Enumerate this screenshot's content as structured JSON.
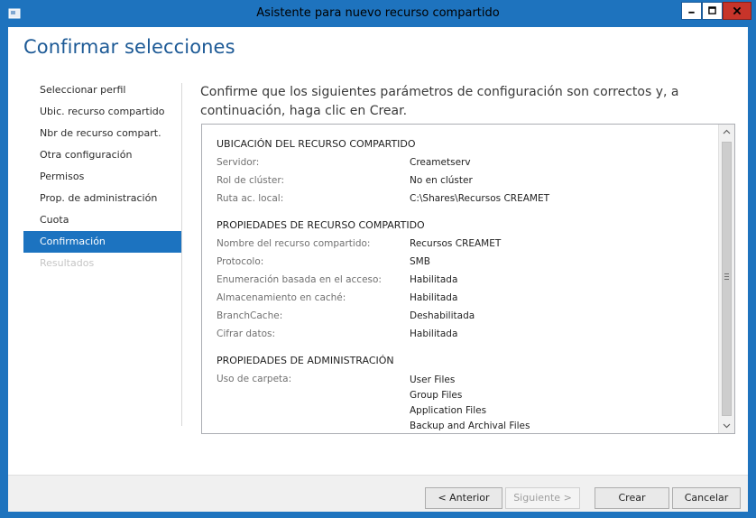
{
  "window": {
    "title": "Asistente para nuevo recurso compartido",
    "icon": "wizard-app-icon",
    "controls": [
      "minimize-icon",
      "maximize-icon",
      "close-icon"
    ]
  },
  "page": {
    "heading": "Confirmar selecciones",
    "intro": "Confirme que los siguientes parámetros de configuración son correctos y, a continuación, haga clic en Crear."
  },
  "nav": {
    "items": [
      {
        "label": "Seleccionar perfil",
        "state": "normal"
      },
      {
        "label": "Ubic. recurso compartido",
        "state": "normal"
      },
      {
        "label": "Nbr de recurso compart.",
        "state": "normal"
      },
      {
        "label": "Otra configuración",
        "state": "normal"
      },
      {
        "label": "Permisos",
        "state": "normal"
      },
      {
        "label": "Prop. de administración",
        "state": "normal"
      },
      {
        "label": "Cuota",
        "state": "normal"
      },
      {
        "label": "Confirmación",
        "state": "active"
      },
      {
        "label": "Resultados",
        "state": "disabled"
      }
    ]
  },
  "summary": {
    "sections": [
      {
        "title": "UBICACIÓN DEL RECURSO COMPARTIDO",
        "rows": [
          {
            "label": "Servidor:",
            "value": "Creametserv"
          },
          {
            "label": "Rol de clúster:",
            "value": "No en clúster"
          },
          {
            "label": "Ruta ac. local:",
            "value": "C:\\Shares\\Recursos CREAMET"
          }
        ]
      },
      {
        "title": "PROPIEDADES DE RECURSO COMPARTIDO",
        "rows": [
          {
            "label": "Nombre del recurso compartido:",
            "value": "Recursos CREAMET"
          },
          {
            "label": "Protocolo:",
            "value": "SMB"
          },
          {
            "label": "Enumeración basada en el acceso:",
            "value": "Habilitada"
          },
          {
            "label": "Almacenamiento en caché:",
            "value": "Habilitada"
          },
          {
            "label": "BranchCache:",
            "value": "Deshabilitada"
          },
          {
            "label": "Cifrar datos:",
            "value": "Habilitada"
          }
        ]
      },
      {
        "title": "PROPIEDADES DE ADMINISTRACIÓN",
        "rows": [
          {
            "label": "Uso de carpeta:",
            "values": [
              "User Files",
              "Group Files",
              "Application Files",
              "Backup and Archival Files"
            ]
          }
        ]
      }
    ]
  },
  "buttons": {
    "prev": "< Anterior",
    "next": "Siguiente >",
    "create": "Crear",
    "cancel": "Cancelar"
  },
  "colors": {
    "titlebar": "#1e73be",
    "heading": "#1d5a96",
    "nav_active": "#1c73c0",
    "close_button": "#c7342a"
  }
}
